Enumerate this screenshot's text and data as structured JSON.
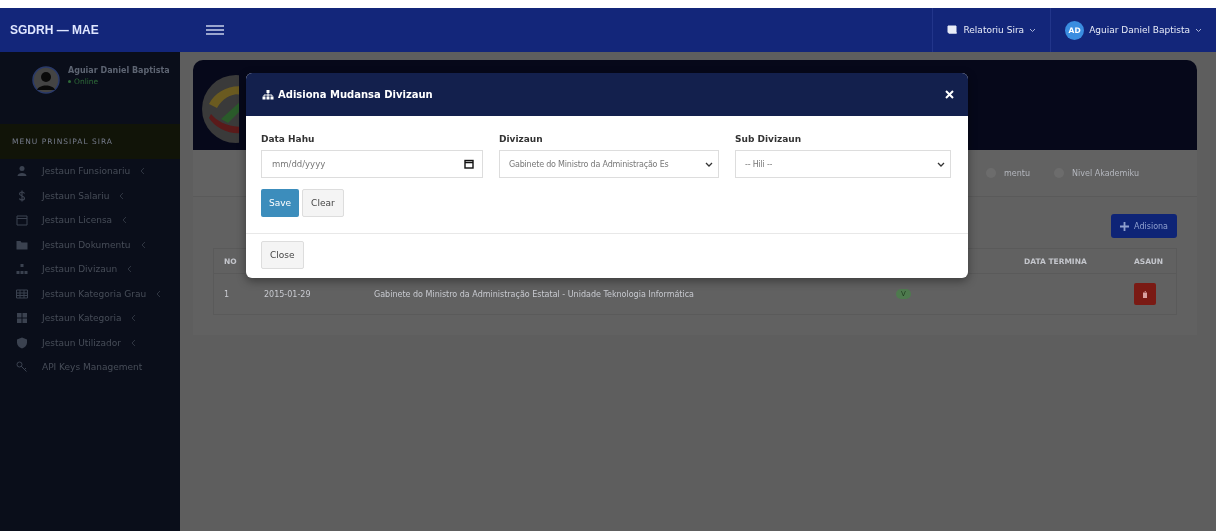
{
  "navbar": {
    "brand": "SGDRH — MAE",
    "reports_menu": "Relatoriu Sira",
    "user_initials": "AD",
    "user_name": "Aguiar Daniel Baptista"
  },
  "sidebar": {
    "user_name": "Aguiar Daniel Baptista",
    "status": "Online",
    "section_title": "MENU PRINSIPAL SIRA",
    "items": [
      {
        "label": "Jestaun Funsionariu",
        "has_submenu": true
      },
      {
        "label": "Jestaun Salariu",
        "has_submenu": true
      },
      {
        "label": "Jestaun Licensa",
        "has_submenu": true
      },
      {
        "label": "Jestaun Dokumentu",
        "has_submenu": true
      },
      {
        "label": "Jestaun Divizaun",
        "has_submenu": true
      },
      {
        "label": "Jestaun Kategoria Grau",
        "has_submenu": true
      },
      {
        "label": "Jestaun Kategoria",
        "has_submenu": true
      },
      {
        "label": "Jestaun Utilizador",
        "has_submenu": true
      },
      {
        "label": "API Keys Management",
        "has_submenu": false
      }
    ]
  },
  "main": {
    "tabs": [
      "mentu",
      "Nivel Akademiku"
    ],
    "add_button": "Adisiona",
    "table": {
      "columns": [
        "NO",
        "DATA TERMINA",
        "ASAUN"
      ],
      "rows": [
        {
          "no": "1",
          "start": "2015-01-29",
          "division": "Gabinete do Ministro da Administração Estatal - Unidade Teknologia Informática",
          "status": "V"
        }
      ]
    }
  },
  "modal": {
    "title": "Adisiona Mudansa Divizaun",
    "fields": [
      {
        "label": "Data Hahu",
        "kind": "date",
        "placeholder": "mm/dd/yyyy"
      },
      {
        "label": "Divizaun",
        "kind": "select",
        "value": "Gabinete do Ministro da Administração Es"
      },
      {
        "label": "Sub Divizaun",
        "kind": "select",
        "value": "-- Hili --"
      }
    ],
    "save": "Save",
    "clear": "Clear",
    "close": "Close"
  }
}
